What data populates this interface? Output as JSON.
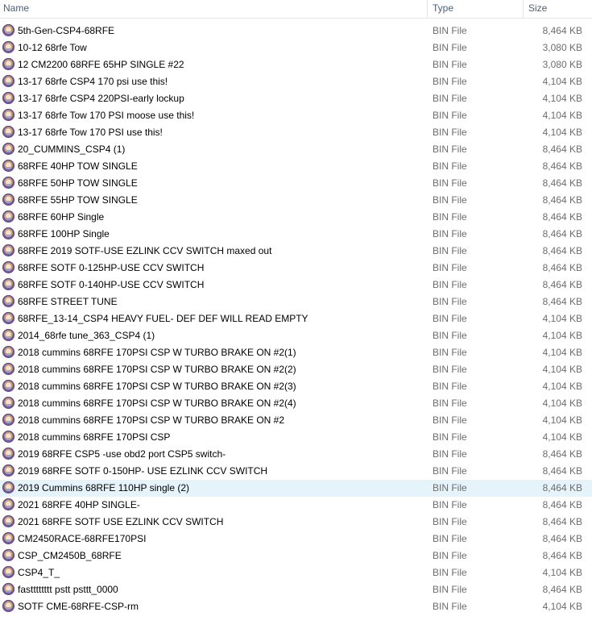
{
  "columns": {
    "name": "Name",
    "type": "Type",
    "size": "Size"
  },
  "selected_index": 27,
  "files": [
    {
      "name": "5th-Gen-CSP4-68RFE",
      "type": "BIN File",
      "size": "8,464 KB"
    },
    {
      "name": "10-12 68rfe Tow",
      "type": "BIN File",
      "size": "3,080 KB"
    },
    {
      "name": "12 CM2200 68RFE 65HP SINGLE #22",
      "type": "BIN File",
      "size": "3,080 KB"
    },
    {
      "name": "13-17 68rfe CSP4 170 psi use this!",
      "type": "BIN File",
      "size": "4,104 KB"
    },
    {
      "name": "13-17 68rfe CSP4 220PSI-early lockup",
      "type": "BIN File",
      "size": "4,104 KB"
    },
    {
      "name": "13-17 68rfe Tow 170 PSI moose use this!",
      "type": "BIN File",
      "size": "4,104 KB"
    },
    {
      "name": "13-17 68rfe Tow 170 PSI use this!",
      "type": "BIN File",
      "size": "4,104 KB"
    },
    {
      "name": "20_CUMMINS_CSP4 (1)",
      "type": "BIN File",
      "size": "8,464 KB"
    },
    {
      "name": "68RFE 40HP TOW SINGLE",
      "type": "BIN File",
      "size": "8,464 KB"
    },
    {
      "name": "68RFE 50HP TOW SINGLE",
      "type": "BIN File",
      "size": "8,464 KB"
    },
    {
      "name": "68RFE 55HP TOW SINGLE",
      "type": "BIN File",
      "size": "8,464 KB"
    },
    {
      "name": "68RFE 60HP Single",
      "type": "BIN File",
      "size": "8,464 KB"
    },
    {
      "name": "68RFE 100HP Single",
      "type": "BIN File",
      "size": "8,464 KB"
    },
    {
      "name": "68RFE 2019 SOTF-USE EZLINK CCV SWITCH maxed out",
      "type": "BIN File",
      "size": "8,464 KB"
    },
    {
      "name": "68RFE SOTF 0-125HP-USE CCV SWITCH",
      "type": "BIN File",
      "size": "8,464 KB"
    },
    {
      "name": "68RFE SOTF 0-140HP-USE CCV SWITCH",
      "type": "BIN File",
      "size": "8,464 KB"
    },
    {
      "name": "68RFE STREET TUNE",
      "type": "BIN File",
      "size": "8,464 KB"
    },
    {
      "name": "68RFE_13-14_CSP4 HEAVY FUEL- DEF DEF WILL READ EMPTY",
      "type": "BIN File",
      "size": "4,104 KB"
    },
    {
      "name": "2014_68rfe tune_363_CSP4 (1)",
      "type": "BIN File",
      "size": "4,104 KB"
    },
    {
      "name": "2018 cummins 68RFE 170PSI CSP W TURBO BRAKE ON #2(1)",
      "type": "BIN File",
      "size": "4,104 KB"
    },
    {
      "name": "2018 cummins 68RFE 170PSI CSP W TURBO BRAKE ON #2(2)",
      "type": "BIN File",
      "size": "4,104 KB"
    },
    {
      "name": "2018 cummins 68RFE 170PSI CSP W TURBO BRAKE ON #2(3)",
      "type": "BIN File",
      "size": "4,104 KB"
    },
    {
      "name": "2018 cummins 68RFE 170PSI CSP W TURBO BRAKE ON #2(4)",
      "type": "BIN File",
      "size": "4,104 KB"
    },
    {
      "name": "2018 cummins 68RFE 170PSI CSP W TURBO BRAKE ON #2",
      "type": "BIN File",
      "size": "4,104 KB"
    },
    {
      "name": "2018 cummins 68RFE 170PSI CSP",
      "type": "BIN File",
      "size": "4,104 KB"
    },
    {
      "name": "2019 68RFE CSP5 -use obd2 port CSP5 switch-",
      "type": "BIN File",
      "size": "8,464 KB"
    },
    {
      "name": "2019 68RFE SOTF 0-150HP- USE EZLINK CCV SWITCH",
      "type": "BIN File",
      "size": "8,464 KB"
    },
    {
      "name": "2019 Cummins 68RFE 110HP single (2)",
      "type": "BIN File",
      "size": "8,464 KB"
    },
    {
      "name": "2021 68RFE 40HP SINGLE-",
      "type": "BIN File",
      "size": "8,464 KB"
    },
    {
      "name": "2021 68RFE SOTF USE EZLINK CCV SWITCH",
      "type": "BIN File",
      "size": "8,464 KB"
    },
    {
      "name": "CM2450RACE-68RFE170PSI",
      "type": "BIN File",
      "size": "8,464 KB"
    },
    {
      "name": "CSP_CM2450B_68RFE",
      "type": "BIN File",
      "size": "8,464 KB"
    },
    {
      "name": "CSP4_T_",
      "type": "BIN File",
      "size": "4,104 KB"
    },
    {
      "name": "fastttttttt pstt psttt_0000",
      "type": "BIN File",
      "size": "8,464 KB"
    },
    {
      "name": "SOTF CME-68RFE-CSP-rm",
      "type": "BIN File",
      "size": "4,104 KB"
    }
  ]
}
